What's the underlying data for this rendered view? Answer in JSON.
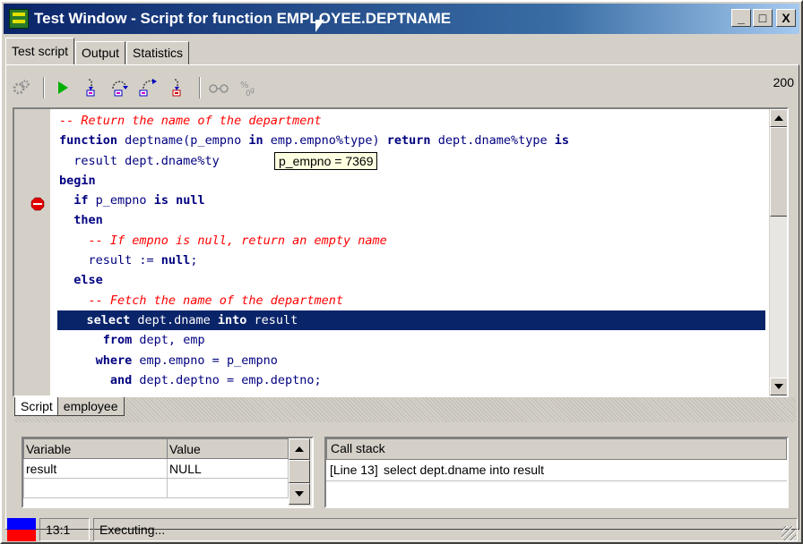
{
  "window": {
    "title": "Test Window - Script for function EMPLOYEE.DEPTNAME",
    "minimize_glyph": "_",
    "maximize_glyph": "□",
    "close_glyph": "X"
  },
  "tabs": [
    "Test script",
    "Output",
    "Statistics"
  ],
  "toolbar": {
    "count": "200",
    "icons": [
      "execute-icon",
      "step-into-icon",
      "step-over-icon",
      "step-out-icon",
      "run-to-exception-icon",
      "watch-icon",
      "breakpoint-list-icon"
    ]
  },
  "editor": {
    "lines": [
      {
        "parts": [
          {
            "t": "-- Return the name of the department",
            "c": "cm"
          }
        ],
        "indent": 0
      },
      {
        "parts": [
          {
            "t": "function",
            "c": "kw"
          },
          {
            "t": " deptname(p_empno "
          },
          {
            "t": "in",
            "c": "kw"
          },
          {
            "t": " emp.empno%type) "
          },
          {
            "t": "return",
            "c": "kw"
          },
          {
            "t": " dept.dname%type "
          },
          {
            "t": "is",
            "c": "kw"
          }
        ],
        "indent": 0
      },
      {
        "parts": [
          {
            "t": "  result dept.dname%ty"
          }
        ],
        "indent": 0
      },
      {
        "parts": [
          {
            "t": "begin",
            "c": "kw"
          }
        ],
        "indent": 0
      },
      {
        "parts": [
          {
            "t": "  "
          },
          {
            "t": "if",
            "c": "kw"
          },
          {
            "t": " p_empno "
          },
          {
            "t": "is null",
            "c": "kw"
          }
        ],
        "indent": 0
      },
      {
        "parts": [
          {
            "t": "  "
          },
          {
            "t": "then",
            "c": "kw"
          }
        ],
        "indent": 0
      },
      {
        "parts": [
          {
            "t": "    -- If empno is null, return an empty name",
            "c": "cm"
          }
        ],
        "indent": 0
      },
      {
        "parts": [
          {
            "t": "    result := "
          },
          {
            "t": "null",
            "c": "kw"
          },
          {
            "t": ";"
          }
        ],
        "indent": 0
      },
      {
        "parts": [
          {
            "t": "  "
          },
          {
            "t": "else",
            "c": "kw"
          }
        ],
        "indent": 0
      },
      {
        "parts": [
          {
            "t": "    -- Fetch the name of the department",
            "c": "cm"
          }
        ],
        "indent": 0
      },
      {
        "parts": [
          {
            "t": "    "
          },
          {
            "t": "select",
            "c": "kw"
          },
          {
            "t": " dept.dname "
          },
          {
            "t": "into",
            "c": "kw"
          },
          {
            "t": " result"
          }
        ],
        "indent": 0,
        "highlight": true
      },
      {
        "parts": [
          {
            "t": "      "
          },
          {
            "t": "from",
            "c": "kw"
          },
          {
            "t": " dept, emp"
          }
        ],
        "indent": 0
      },
      {
        "parts": [
          {
            "t": "     "
          },
          {
            "t": "where",
            "c": "kw"
          },
          {
            "t": " emp.empno = p_empno"
          }
        ],
        "indent": 0
      },
      {
        "parts": [
          {
            "t": "       "
          },
          {
            "t": "and",
            "c": "kw"
          },
          {
            "t": " dept.deptno = emp.deptno;"
          }
        ],
        "indent": 0
      }
    ],
    "tooltip": "p_empno = 7369",
    "breakpoint_line": 4
  },
  "bottom_tabs": [
    "Script",
    "employee"
  ],
  "variables": {
    "headers": [
      "Variable",
      "Value"
    ],
    "rows": [
      [
        "result",
        "NULL"
      ],
      [
        "",
        ""
      ]
    ]
  },
  "callstack": {
    "header": "Call stack",
    "rows": [
      {
        "line": "[Line 13]",
        "text": "select dept.dname into result"
      }
    ]
  },
  "status": {
    "position": "13:1",
    "message": "Executing...",
    "colors": [
      "#0000ff",
      "#ff0000"
    ]
  }
}
